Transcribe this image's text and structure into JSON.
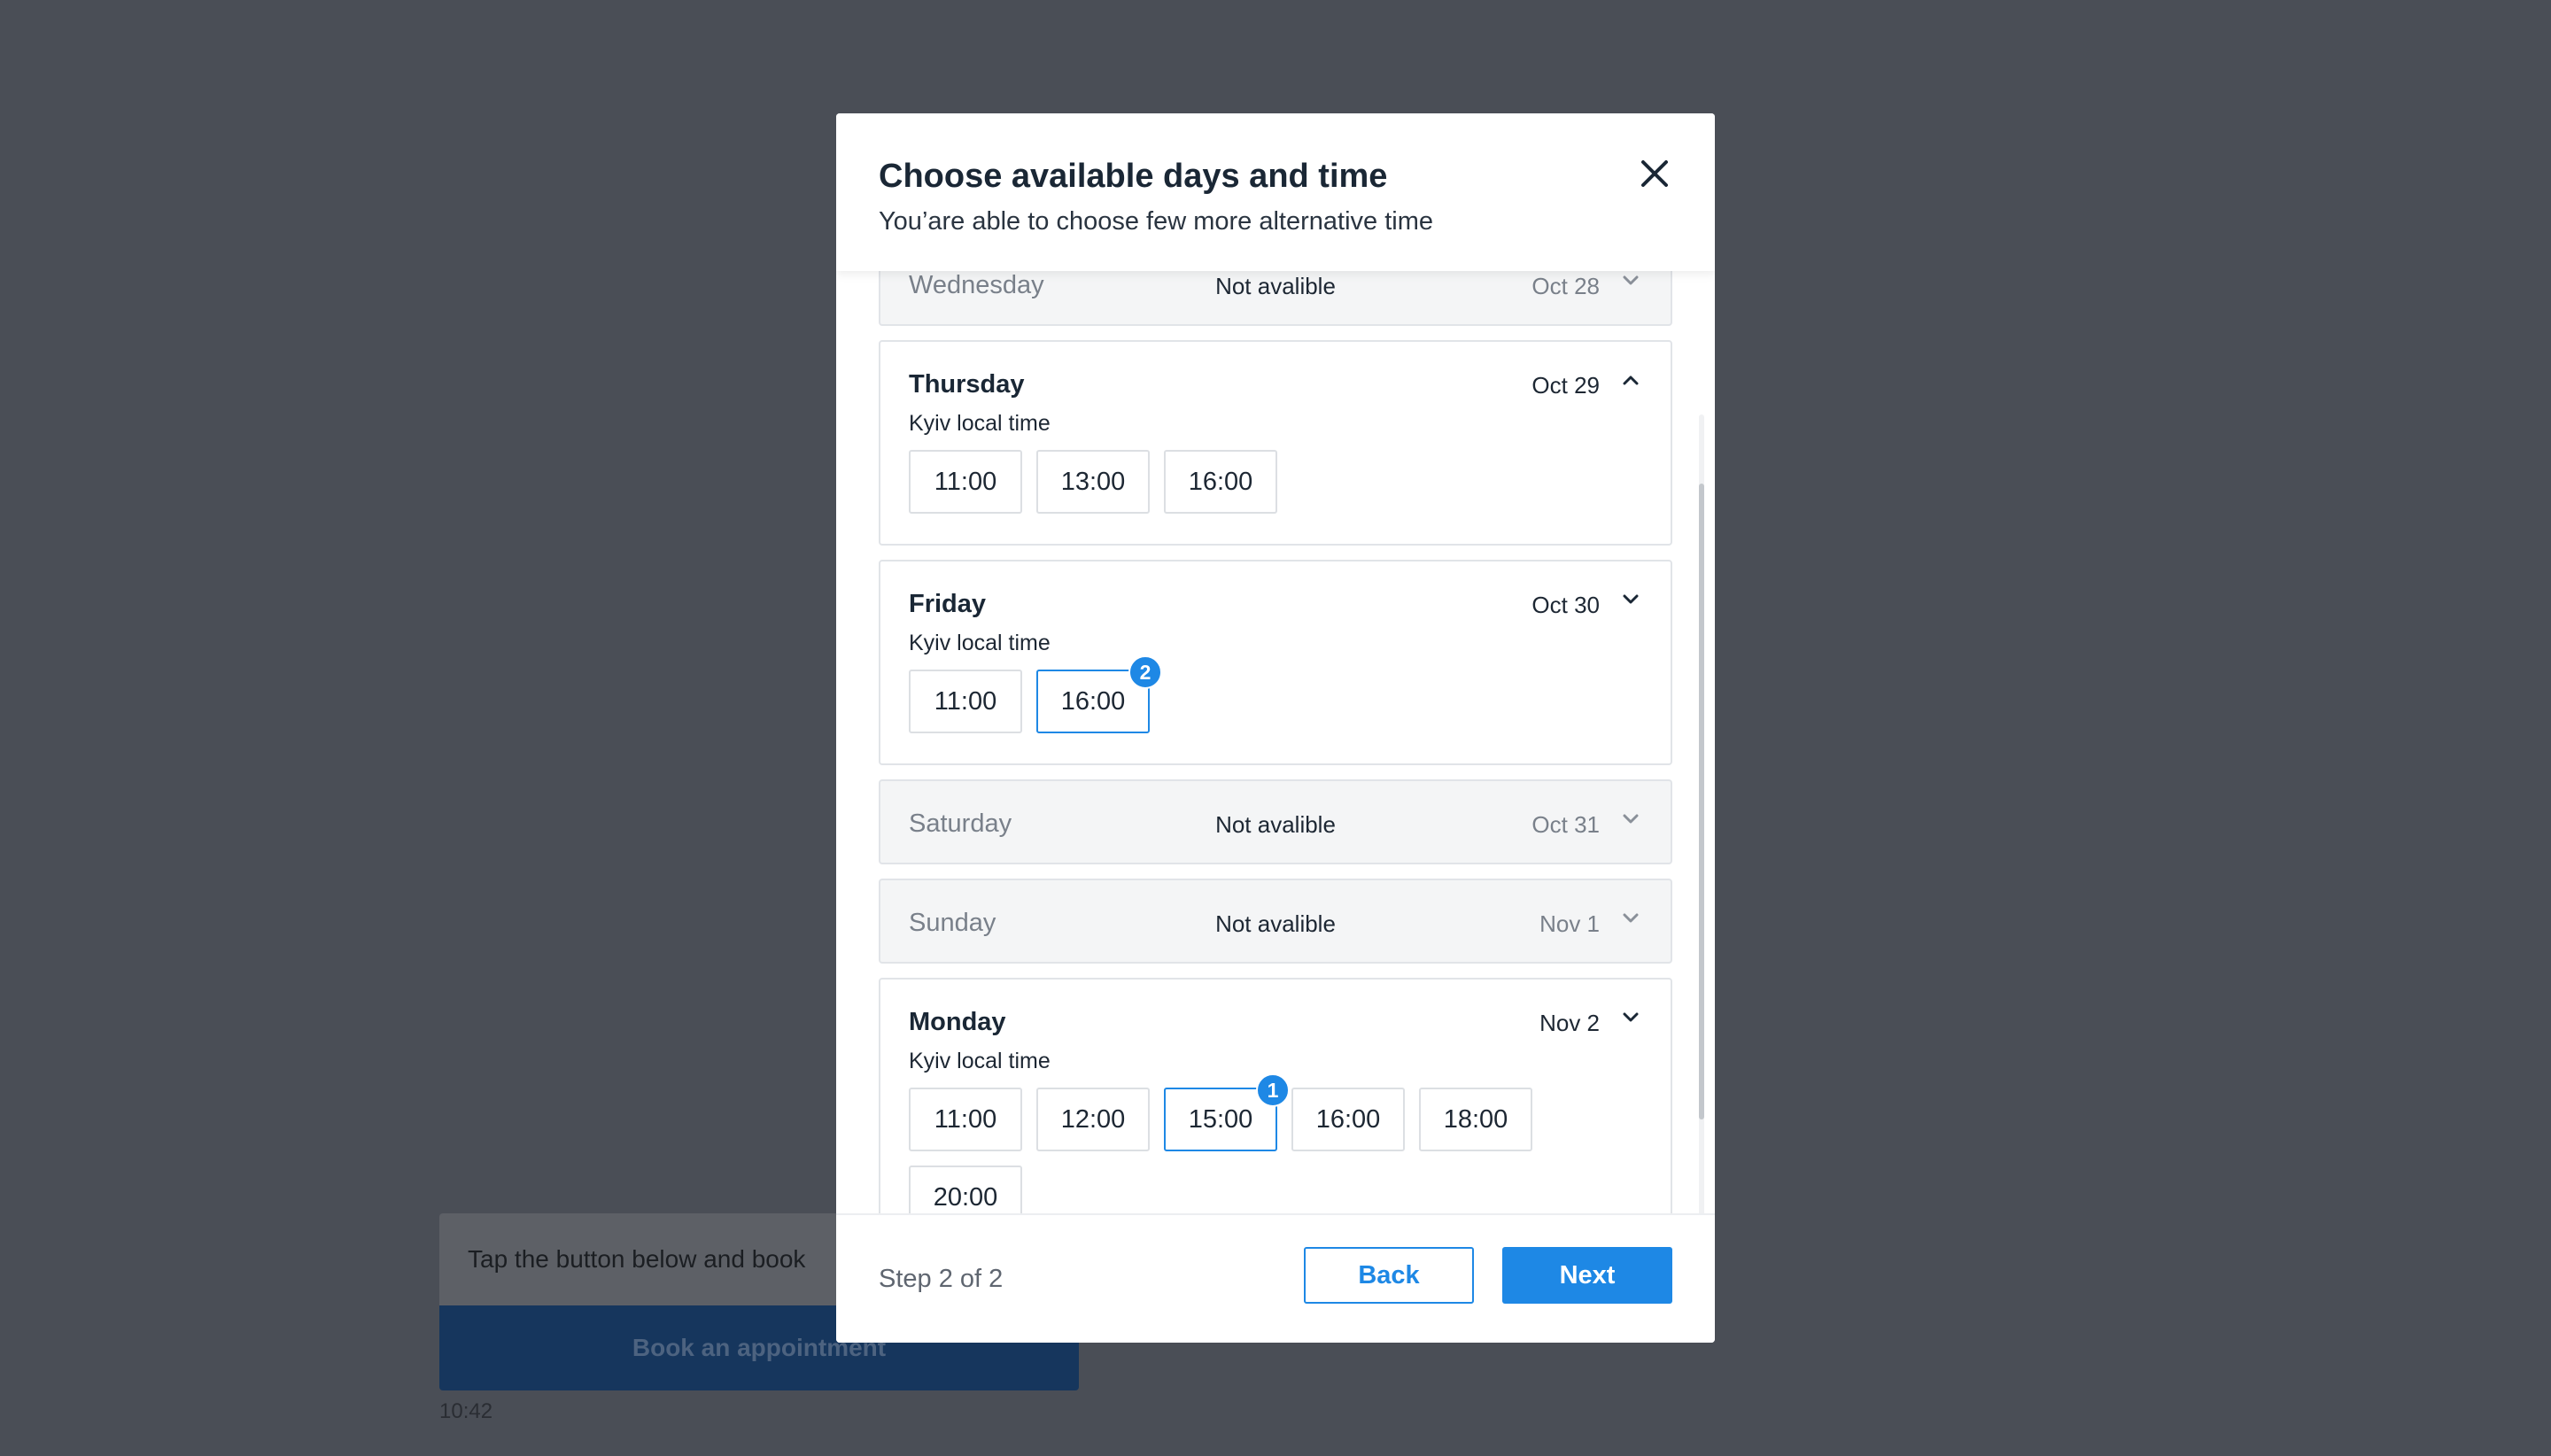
{
  "background_chat": {
    "message": "Tap the button below and book",
    "button_label": "Book an appointment",
    "time": "10:42"
  },
  "modal": {
    "title": "Choose available days and time",
    "subtitle": "You’are able to choose few more alternative time",
    "close_icon": "close-icon"
  },
  "days": [
    {
      "name": "Wednesday",
      "date": "Oct 28",
      "available": false,
      "status": "Not avalible"
    },
    {
      "name": "Thursday",
      "date": "Oct 29",
      "available": true,
      "expanded": true,
      "timezone": "Kyiv local time",
      "slots": [
        {
          "time": "11:00"
        },
        {
          "time": "13:00"
        },
        {
          "time": "16:00"
        }
      ]
    },
    {
      "name": "Friday",
      "date": "Oct 30",
      "available": true,
      "expanded": false,
      "timezone": "Kyiv local time",
      "slots": [
        {
          "time": "11:00"
        },
        {
          "time": "16:00",
          "selected": true,
          "order": "2"
        }
      ]
    },
    {
      "name": "Saturday",
      "date": "Oct 31",
      "available": false,
      "status": "Not avalible"
    },
    {
      "name": "Sunday",
      "date": "Nov 1",
      "available": false,
      "status": "Not avalible"
    },
    {
      "name": "Monday",
      "date": "Nov 2",
      "available": true,
      "expanded": false,
      "timezone": "Kyiv local time",
      "slots": [
        {
          "time": "11:00"
        },
        {
          "time": "12:00"
        },
        {
          "time": "15:00",
          "selected": true,
          "order": "1"
        },
        {
          "time": "16:00"
        },
        {
          "time": "18:00"
        },
        {
          "time": "20:00"
        }
      ]
    }
  ],
  "footer": {
    "step": "Step 2 of 2",
    "back_label": "Back",
    "next_label": "Next"
  },
  "colors": {
    "accent": "#1e88e5",
    "overlay": "#4a4e56",
    "unavailable_bg": "#f4f5f6"
  }
}
